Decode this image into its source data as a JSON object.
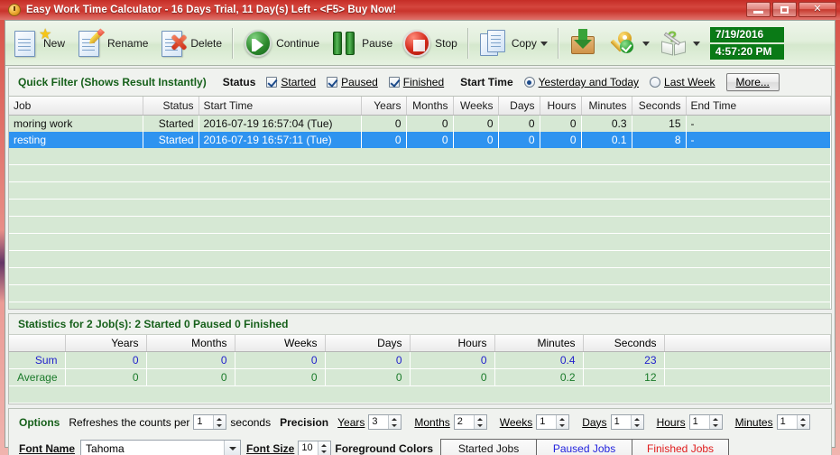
{
  "window": {
    "title": "Easy Work Time Calculator - 16 Days Trial, 11 Day(s) Left  - <F5> Buy Now!",
    "app_icon": "clock-icon",
    "minimize": "minimize-icon",
    "maximize": "maximize-icon",
    "close": "close-icon"
  },
  "toolbar": {
    "new_label": "New",
    "rename_label": "Rename",
    "delete_label": "Delete",
    "continue_label": "Continue",
    "pause_label": "Pause",
    "stop_label": "Stop",
    "copy_label": "Copy",
    "date_value": "7/19/2016",
    "time_value": "4:57:20 PM"
  },
  "quick_filter": {
    "title": "Quick Filter (Shows Result Instantly)",
    "status_label": "Status",
    "status_options": [
      {
        "label": "Started",
        "checked": true
      },
      {
        "label": "Paused",
        "checked": true
      },
      {
        "label": "Finished",
        "checked": true
      }
    ],
    "start_time_label": "Start Time",
    "range_options": [
      {
        "label": "Yesterday and Today",
        "selected": true
      },
      {
        "label": "Last Week",
        "selected": false
      }
    ],
    "more_label": "More..."
  },
  "grid": {
    "columns": [
      "Job",
      "Status",
      "Start Time",
      "Years",
      "Months",
      "Weeks",
      "Days",
      "Hours",
      "Minutes",
      "Seconds",
      "End Time"
    ],
    "rows": [
      {
        "selected": false,
        "cells": [
          "moring work",
          "Started",
          "2016-07-19 16:57:04 (Tue)",
          "0",
          "0",
          "0",
          "0",
          "0",
          "0.3",
          "15",
          "-"
        ]
      },
      {
        "selected": true,
        "cells": [
          "resting",
          "Started",
          "2016-07-19 16:57:11 (Tue)",
          "0",
          "0",
          "0",
          "0",
          "0",
          "0.1",
          "8",
          "-"
        ]
      }
    ]
  },
  "statistics": {
    "header": "Statistics for 2 Job(s): 2 Started 0 Paused 0 Finished",
    "columns": [
      "",
      "Years",
      "Months",
      "Weeks",
      "Days",
      "Hours",
      "Minutes",
      "Seconds",
      ""
    ],
    "rows": [
      {
        "label": "Sum",
        "values": [
          "0",
          "0",
          "0",
          "0",
          "0",
          "0.4",
          "23"
        ],
        "color": "#2222cc"
      },
      {
        "label": "Average",
        "values": [
          "0",
          "0",
          "0",
          "0",
          "0",
          "0.2",
          "12"
        ],
        "color": "#1a7a2a"
      }
    ]
  },
  "options": {
    "title": "Options",
    "refresh_text_a": "Refreshes the counts per",
    "refresh_value": "1",
    "refresh_text_b": "seconds",
    "precision_label": "Precision",
    "precision_fields": [
      {
        "label": "Years",
        "value": "3"
      },
      {
        "label": "Months",
        "value": "2"
      },
      {
        "label": "Weeks",
        "value": "1"
      },
      {
        "label": "Days",
        "value": "1"
      },
      {
        "label": "Hours",
        "value": "1"
      },
      {
        "label": "Minutes",
        "value": "1"
      }
    ],
    "font_name_label": "Font Name",
    "font_name_value": "Tahoma",
    "font_size_label": "Font Size",
    "font_size_value": "10",
    "foreground_colors_label": "Foreground Colors",
    "color_buttons": [
      {
        "label": "Started Jobs",
        "color": "#111111"
      },
      {
        "label": "Paused Jobs",
        "color": "#2222dd"
      },
      {
        "label": "Finished Jobs",
        "color": "#e01b1b"
      }
    ]
  }
}
